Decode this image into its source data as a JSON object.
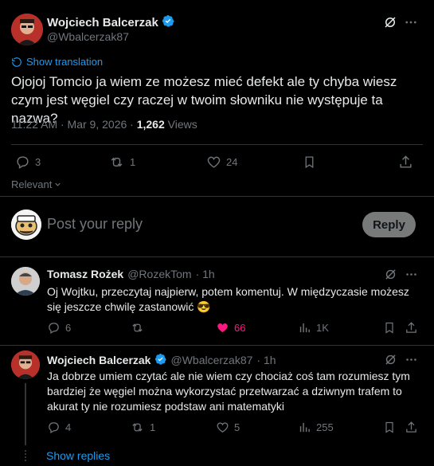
{
  "main_tweet": {
    "author_name": "Wojciech Balcerzak",
    "author_handle": "@Wbalcerzak87",
    "show_translation": "Show translation",
    "text": "Ojojoj Tomcio ja wiem ze możesz mieć defekt ale ty chyba wiesz czym jest węgiel czy raczej w twoim słowniku nie występuje ta nazwa?",
    "timestamp": "11:22 AM · Mar 9, 2026 · ",
    "views_count": "1,262",
    "views_label": " Views",
    "stats": {
      "replies": "3",
      "retweets": "1",
      "likes": "24"
    },
    "sort_label": "Relevant"
  },
  "composer": {
    "placeholder": "Post your reply",
    "reply_button": "Reply"
  },
  "replies": [
    {
      "author_name": "Tomasz Rożek",
      "author_handle": "@RozekTom",
      "time": "· 1h",
      "text": "Oj Wojtku, przeczytaj najpierw, potem komentuj. W międzyczasie możesz się jeszcze chwilę zastanowić 😎",
      "stats": {
        "replies": "6",
        "retweets": "",
        "likes": "66",
        "views": "1K"
      },
      "liked": true
    },
    {
      "author_name": "Wojciech Balcerzak",
      "author_handle": "@Wbalcerzak87",
      "time": "· 1h",
      "text": "Ja dobrze umiem czytać ale nie wiem czy chociaż coś tam rozumiesz tym bardziej że węgiel można wykorzystać przetwarzać a dziwnym trafem to akurat ty nie rozumiesz podstaw ani matematyki",
      "stats": {
        "replies": "4",
        "retweets": "1",
        "likes": "5",
        "views": "255"
      },
      "liked": false
    }
  ],
  "show_replies": "Show replies",
  "colors": {
    "accent": "#1d9bf0",
    "like_active": "#f91880",
    "muted": "#71767b"
  }
}
